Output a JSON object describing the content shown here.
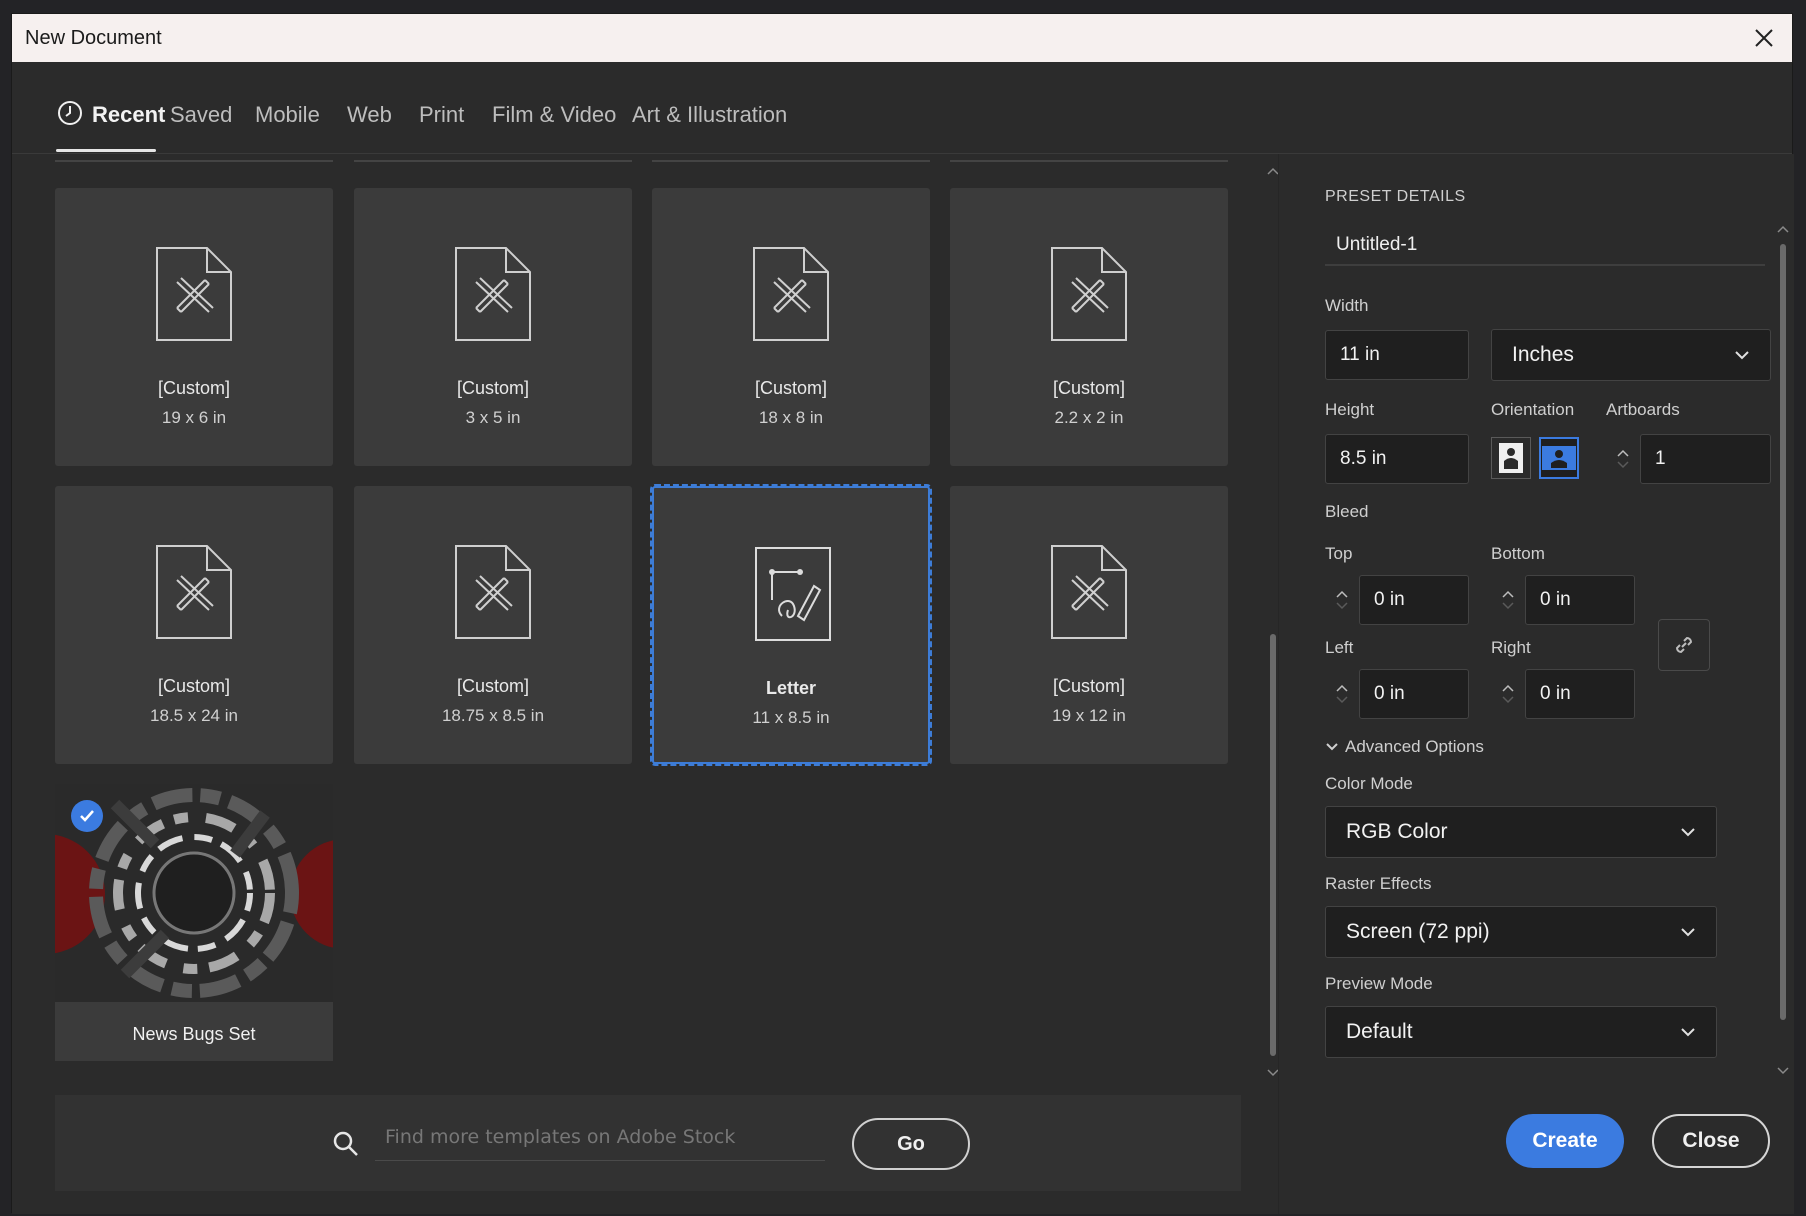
{
  "window": {
    "title": "New Document"
  },
  "tabs": [
    {
      "label": "Recent",
      "active": true
    },
    {
      "label": "Saved"
    },
    {
      "label": "Mobile"
    },
    {
      "label": "Web"
    },
    {
      "label": "Print"
    },
    {
      "label": "Film & Video"
    },
    {
      "label": "Art & Illustration"
    }
  ],
  "presets": [
    {
      "name": "[Custom]",
      "size": "19 x 6 in"
    },
    {
      "name": "[Custom]",
      "size": "3 x 5 in"
    },
    {
      "name": "[Custom]",
      "size": "18 x 8 in"
    },
    {
      "name": "[Custom]",
      "size": "2.2 x 2 in"
    },
    {
      "name": "[Custom]",
      "size": "18.5 x 24 in"
    },
    {
      "name": "[Custom]",
      "size": "18.75 x 8.5 in"
    },
    {
      "name": "Letter",
      "size": "11 x 8.5 in",
      "selected": true
    },
    {
      "name": "[Custom]",
      "size": "19 x 12 in"
    }
  ],
  "template": {
    "name": "News Bugs Set"
  },
  "search": {
    "placeholder": "Find more templates on Adobe Stock",
    "go_label": "Go"
  },
  "details": {
    "heading": "PRESET DETAILS",
    "doc_name": "Untitled-1",
    "width_label": "Width",
    "width_value": "11 in",
    "units": "Inches",
    "height_label": "Height",
    "height_value": "8.5 in",
    "orientation_label": "Orientation",
    "artboards_label": "Artboards",
    "artboards_value": "1",
    "bleed_label": "Bleed",
    "top_label": "Top",
    "top_value": "0 in",
    "bottom_label": "Bottom",
    "bottom_value": "0 in",
    "left_label": "Left",
    "left_value": "0 in",
    "right_label": "Right",
    "right_value": "0 in",
    "advanced_label": "Advanced Options",
    "color_mode_label": "Color Mode",
    "color_mode_value": "RGB Color",
    "raster_label": "Raster Effects",
    "raster_value": "Screen (72 ppi)",
    "preview_label": "Preview Mode",
    "preview_value": "Default"
  },
  "actions": {
    "create": "Create",
    "close": "Close"
  },
  "colors": {
    "accent": "#3b7be0",
    "card": "#3b3b3b",
    "panel": "#2b2b2b"
  }
}
